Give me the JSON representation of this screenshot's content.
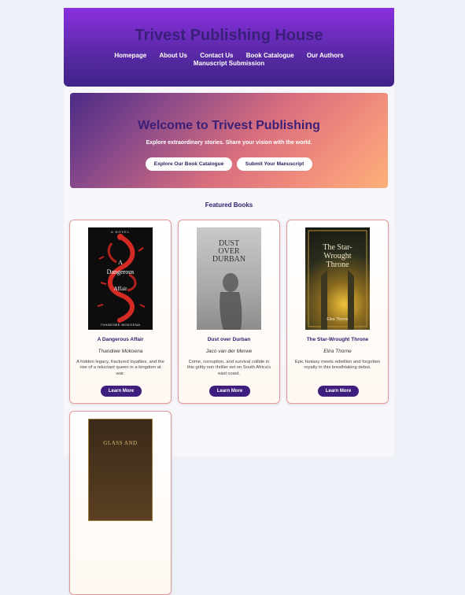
{
  "site": {
    "title": "Trivest Publishing House",
    "nav": [
      "Homepage",
      "About Us",
      "Contact Us",
      "Book Catalogue",
      "Our Authors",
      "Manuscript Submission"
    ]
  },
  "hero": {
    "title": "Welcome to Trivest Publishing",
    "subtitle": "Explore extraordinary stories. Share your vision with the world.",
    "primary_button": "Explore Our Book Catalogue",
    "secondary_button": "Submit Your Manuscript"
  },
  "featured": {
    "heading": "Featured Books",
    "books": [
      {
        "title": "A Dangerous Affair",
        "author": "Thandiwe Mokoena",
        "description": "A hidden legacy, fractured loyalties, and the rise of a reluctant queen in a kingdom at war.",
        "button": "Learn More",
        "cover_top": "A NOVEL",
        "cover_line1": "A",
        "cover_line2": "Dangerous",
        "cover_line3": "Affair",
        "cover_author": "THANDIWE MOKOENA"
      },
      {
        "title": "Dust over Durban",
        "author": "Jaco van der Merwe",
        "description": "Crime, corruption, and survival collide in this gritty noir thriller set on South Africa's east coast.",
        "button": "Learn More",
        "cover_line1": "DUST",
        "cover_line2": "OVER",
        "cover_line3": "DURBAN"
      },
      {
        "title": "The Star-Wrought Throne",
        "author": "Elira Thorne",
        "description": "Epic fantasy meets rebellion and forgotten royalty in this breathtaking debut.",
        "button": "Learn More",
        "cover_line1": "The Star-",
        "cover_line2": "Wrought",
        "cover_line3": "Throne",
        "cover_author": "Elira Thorne"
      },
      {
        "cover_line1": "GLASS AND"
      }
    ]
  },
  "colors": {
    "header_gradient_top": "#8a2fe0",
    "header_gradient_bottom": "#3f2386",
    "accent_dark_purple": "#3e1f7e",
    "card_border": "#e29a9a"
  }
}
